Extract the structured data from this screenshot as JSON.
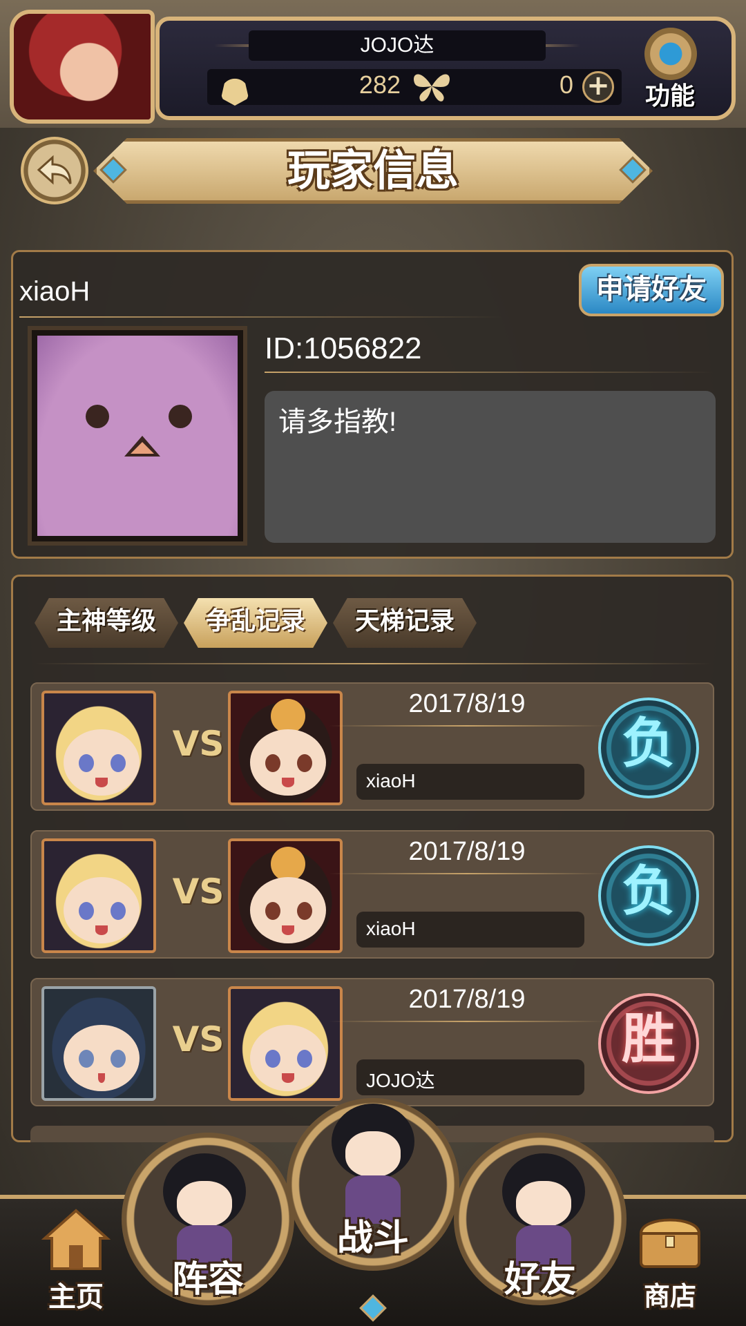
{
  "top_bar": {
    "player_name": "JOJO达",
    "resource_1_value": "282",
    "resource_2_value": "0",
    "function_label": "功能",
    "icons": [
      "flame-icon",
      "butterfly-icon",
      "plus-icon",
      "gear-icon"
    ]
  },
  "header": {
    "title": "玩家信息",
    "back_icon": "back-arrow-icon"
  },
  "profile": {
    "name": "xiaoH",
    "add_friend_label": "申请好友",
    "id_text": "ID:1056822",
    "bio": "请多指教!"
  },
  "records": {
    "tabs": [
      {
        "label": "主神等级",
        "active": false
      },
      {
        "label": "争乱记录",
        "active": true
      },
      {
        "label": "天梯记录",
        "active": false
      }
    ],
    "vs_label": "VS",
    "rows": [
      {
        "date": "2017/8/19",
        "opponent": "xiaoH",
        "result": "负",
        "result_type": "lose"
      },
      {
        "date": "2017/8/19",
        "opponent": "xiaoH",
        "result": "负",
        "result_type": "lose"
      },
      {
        "date": "2017/8/19",
        "opponent": "JOJO达",
        "result": "胜",
        "result_type": "win"
      }
    ]
  },
  "bottom_nav": {
    "items": [
      {
        "label": "主页",
        "icon": "house-icon"
      },
      {
        "label": "阵容",
        "icon": "team-chibi-icon"
      },
      {
        "label": "战斗",
        "icon": "battle-chibi-icon"
      },
      {
        "label": "好友",
        "icon": "friends-chibi-icon"
      },
      {
        "label": "商店",
        "icon": "treasure-chest-icon"
      }
    ]
  },
  "colors": {
    "gold_frame": "#c9a46a",
    "lose_badge": "#7fdcf0",
    "win_badge": "#f3a3a3",
    "panel_bg": "#2e2a26"
  }
}
